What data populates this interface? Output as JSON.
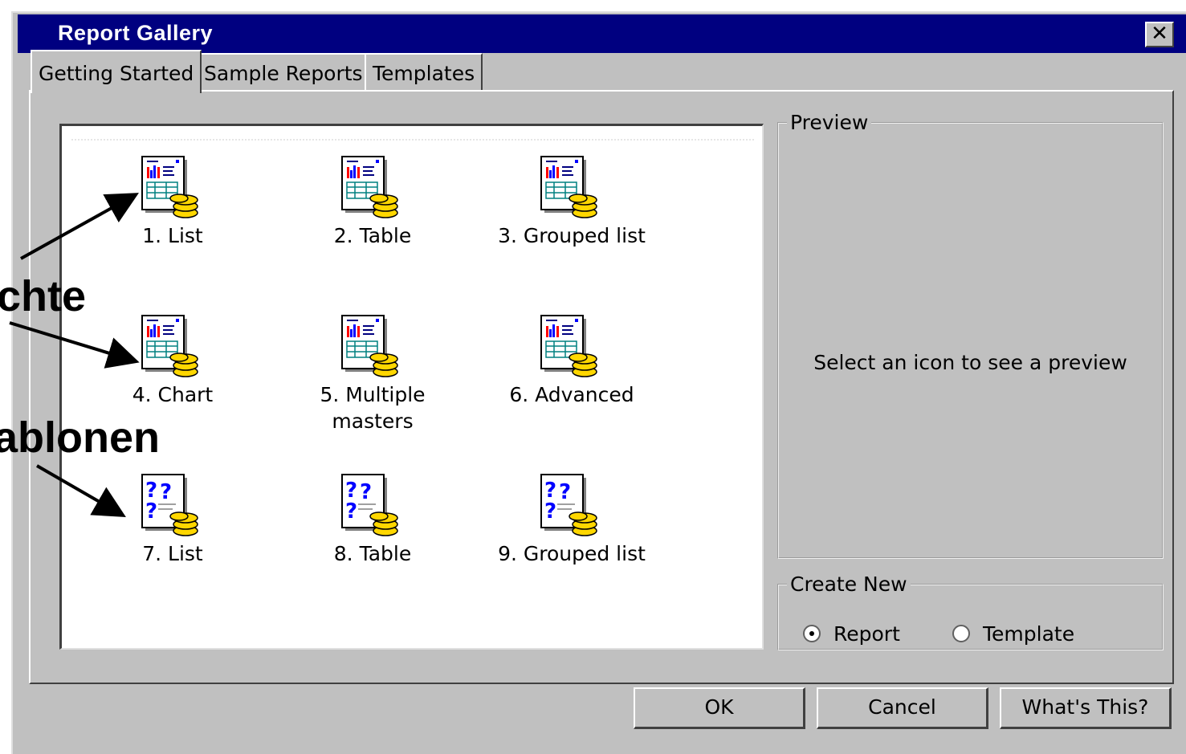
{
  "window": {
    "title": "Report Gallery",
    "close_glyph": "✕"
  },
  "tabs": [
    {
      "label": "Getting Started",
      "active": true
    },
    {
      "label": "Sample Reports",
      "active": false
    },
    {
      "label": "Templates",
      "active": false
    }
  ],
  "gallery": {
    "items": [
      {
        "label": "1. List",
        "icon": "report-icon"
      },
      {
        "label": "2. Table",
        "icon": "report-icon"
      },
      {
        "label": "3. Grouped list",
        "icon": "report-icon"
      },
      {
        "label": "4. Chart",
        "icon": "report-icon"
      },
      {
        "label": "5. Multiple masters",
        "icon": "report-icon"
      },
      {
        "label": "6. Advanced",
        "icon": "report-icon"
      },
      {
        "label": "7. List",
        "icon": "template-icon"
      },
      {
        "label": "8. Table",
        "icon": "template-icon"
      },
      {
        "label": "9. Grouped list",
        "icon": "template-icon"
      }
    ]
  },
  "preview": {
    "legend": "Preview",
    "message": "Select an icon to see a preview"
  },
  "create_new": {
    "legend": "Create New",
    "options": [
      {
        "label": "Report",
        "selected": true
      },
      {
        "label": "Template",
        "selected": false
      }
    ]
  },
  "buttons": {
    "ok": "OK",
    "cancel": "Cancel",
    "whats_this": "What's This?"
  },
  "annotations": {
    "upper": "chte",
    "lower": "ablonen"
  },
  "colors": {
    "titlebar": "#000080",
    "dialog": "#c0c0c0"
  }
}
